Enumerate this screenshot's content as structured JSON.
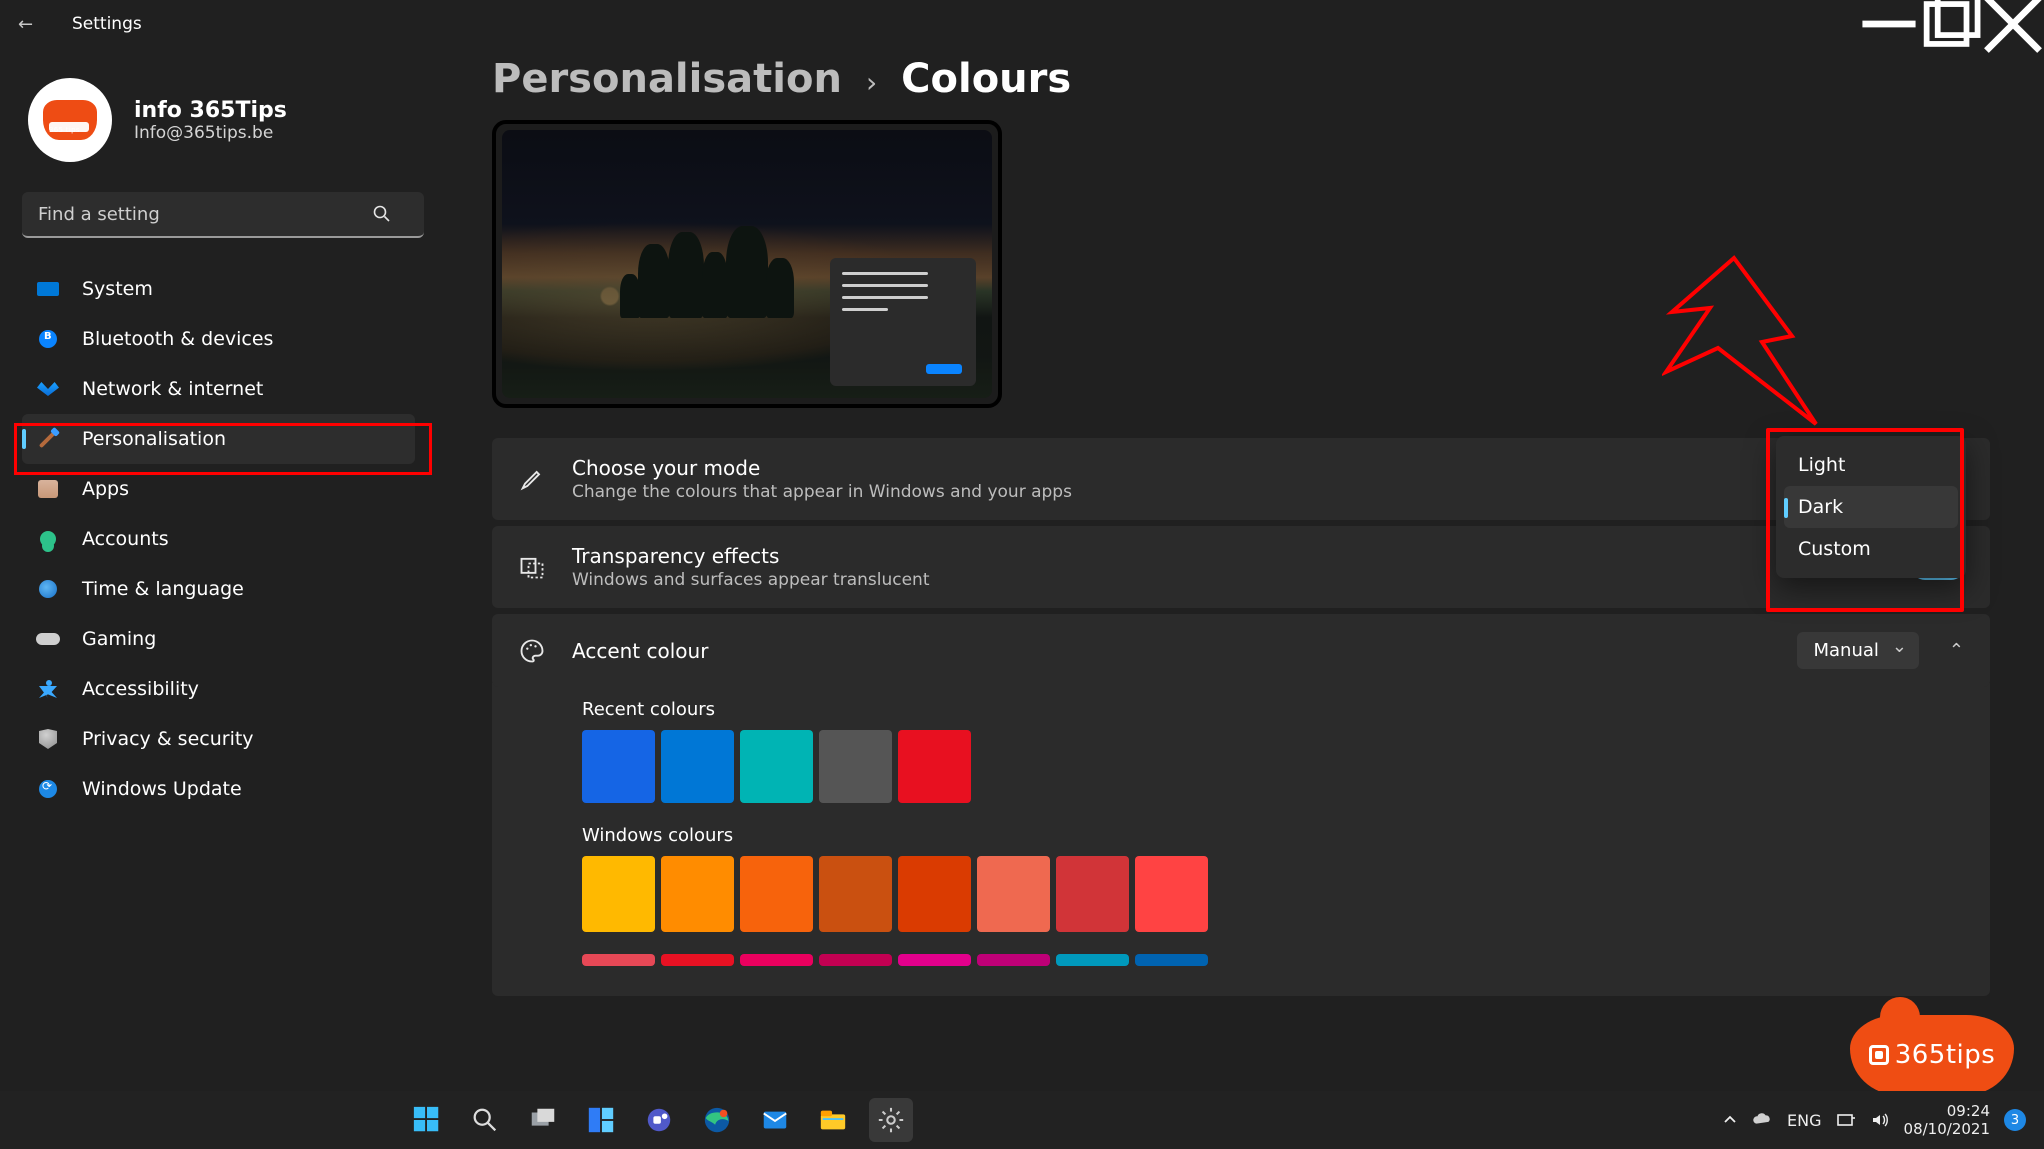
{
  "title": "Settings",
  "user": {
    "name": "info 365Tips",
    "email": "Info@365tips.be"
  },
  "search": {
    "placeholder": "Find a setting"
  },
  "nav": {
    "items": [
      {
        "label": "System"
      },
      {
        "label": "Bluetooth & devices"
      },
      {
        "label": "Network & internet"
      },
      {
        "label": "Personalisation"
      },
      {
        "label": "Apps"
      },
      {
        "label": "Accounts"
      },
      {
        "label": "Time & language"
      },
      {
        "label": "Gaming"
      },
      {
        "label": "Accessibility"
      },
      {
        "label": "Privacy & security"
      },
      {
        "label": "Windows Update"
      }
    ]
  },
  "breadcrumb": {
    "parent": "Personalisation",
    "current": "Colours"
  },
  "rows": {
    "mode": {
      "title": "Choose your mode",
      "desc": "Change the colours that appear in Windows and your apps"
    },
    "transparency": {
      "title": "Transparency effects",
      "desc": "Windows and surfaces appear translucent",
      "state": "On"
    },
    "accent": {
      "title": "Accent colour",
      "select": "Manual"
    }
  },
  "mode_options": {
    "light": "Light",
    "dark": "Dark",
    "custom": "Custom",
    "selected": "Dark"
  },
  "recent_colours_label": "Recent colours",
  "recent_colours": [
    "#1565e5",
    "#0077d6",
    "#00b4b4",
    "#555555",
    "#e81020"
  ],
  "windows_colours_label": "Windows colours",
  "windows_colours_row1": [
    "#ffb900",
    "#ff8c00",
    "#f7630c",
    "#ca5010",
    "#da3b01",
    "#ef6950",
    "#d13438",
    "#ff4343"
  ],
  "windows_colours_row2": [
    "#e74856",
    "#e81123",
    "#ea005e",
    "#c30052",
    "#e3008c",
    "#bf0077",
    "#0099bc",
    "#0063b1"
  ],
  "watermark": "365tips",
  "taskbar": {
    "lang": "ENG",
    "time": "09:24",
    "date": "08/10/2021",
    "badge": "3"
  }
}
